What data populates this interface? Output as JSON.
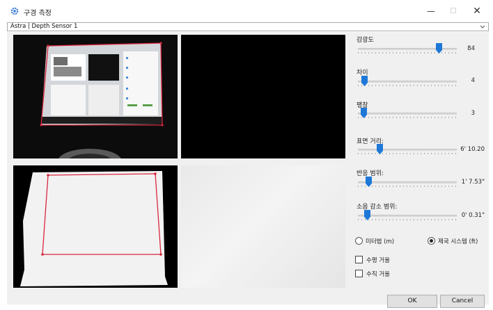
{
  "window": {
    "title": "구경 측정"
  },
  "sensor_select": {
    "value": "Astra | Depth Sensor 1"
  },
  "controls": {
    "sensitivity": {
      "label": "감광도",
      "value": "84",
      "level": 0.84
    },
    "difference": {
      "label": "차이",
      "value": "4",
      "level": 0.04
    },
    "dilation": {
      "label": "팽창",
      "value": "3",
      "level": 0.03
    },
    "surface_distance": {
      "label": "표면 거리:",
      "value": "6' 10.20",
      "level": 0.2
    },
    "response_range": {
      "label": "반응 범위:",
      "value": "1' 7.53\"",
      "level": 0.08
    },
    "noise_reduction_range": {
      "label": "소음 감소 범위:",
      "value": "0' 0.31\"",
      "level": 0.07
    }
  },
  "units": {
    "metric_label": "미터법 (m)",
    "imperial_label": "제국 시스템 (ft)",
    "selected": "imperial"
  },
  "mirror": {
    "horizontal_label": "수평 거울",
    "vertical_label": "수직 거울"
  },
  "buttons": {
    "ok": "OK",
    "cancel": "Cancel"
  },
  "colors": {
    "accent": "#1e78d8",
    "outline": "#d7263d"
  },
  "icons": {
    "app": "settings-gear-icon",
    "minimize": "minimize-icon",
    "maximize": "maximize-icon",
    "close": "close-icon",
    "dropdown": "chevron-down-icon"
  }
}
